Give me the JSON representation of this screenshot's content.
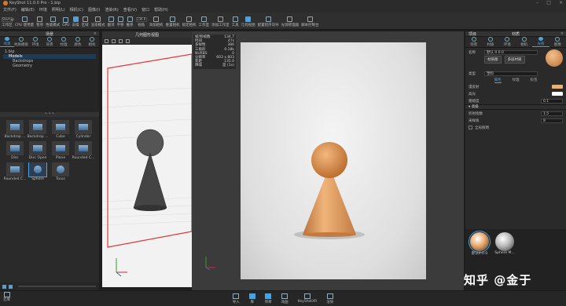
{
  "app": {
    "title": "KeyShot 11.0.0 Pro - 1.bip"
  },
  "menu": [
    "文件(F)",
    "编辑(E)",
    "环境",
    "照明(L)",
    "相机(C)",
    "图像(I)",
    "渲染(R)",
    "查看(V)",
    "窗口",
    "帮助(H)"
  ],
  "toolbar": {
    "workspace": "Startup",
    "cpu_usage": "CPU 使用量",
    "pause": "暂停",
    "perf_mode": "性能模式",
    "gpu": "GPU",
    "denoise": "去噪",
    "region": "区域",
    "render_mode": "渲染模式",
    "zoom": "136.0",
    "scene_tools": [
      "翻译",
      "平移",
      "推移"
    ],
    "perspective": "视角",
    "add_camera": "添加相机",
    "reset_camera": "重置相机",
    "lock_camera": "锁定相机",
    "tool": "工作室",
    "add_ws": "添加工作室",
    "model_tools": "工具",
    "geo_view": "几何视图",
    "config": "配置程序向导",
    "light_mgr": "光源管理器",
    "script": "脚本控制台"
  },
  "left": {
    "header": "场景",
    "tabs": [
      "场景",
      "材质模板",
      "环境",
      "背景",
      "纹理",
      "颜色",
      "相机"
    ],
    "active_tab": 0,
    "tree": [
      {
        "label": "1.bip",
        "indent": 0
      },
      {
        "label": "Models",
        "indent": 1,
        "sel": true
      },
      {
        "label": "Backdrops",
        "indent": 2
      },
      {
        "label": "Geometry",
        "indent": 2
      }
    ],
    "library": [
      "Backdrop ...",
      "Backdrop ...",
      "Cube",
      "Cylinder",
      "Disc",
      "Disc Open",
      "Plane",
      "Rounded C...",
      "Rounded C...",
      "Sphere",
      "Torus"
    ],
    "selected_index": 9
  },
  "geometry_view": {
    "title": "几何图形视图"
  },
  "stats": [
    [
      "帧/秒帧数",
      "134.7"
    ],
    [
      "时间",
      "47s"
    ],
    [
      "多样性",
      "386"
    ],
    [
      "三角形",
      "0.18k"
    ],
    [
      "NURBS",
      "0"
    ],
    [
      "分辨率",
      "603 x 803"
    ],
    [
      "焦距",
      "135.0"
    ],
    [
      "降噪",
      "是 (1x)"
    ]
  ],
  "right": {
    "header_left": "项目",
    "header_right": "材质",
    "tabs": [
      "场景",
      "材质",
      "环境",
      "相机",
      "光照",
      "图像"
    ],
    "active_tab": 4,
    "name_label": "名称",
    "name_value": "默认 0.0.0",
    "btn_graph": "材质图",
    "btn_multi": "多层材质",
    "type_label": "类型",
    "type_value": "塑料",
    "subtabs": [
      "属性",
      "纹理",
      "标签"
    ],
    "active_subtab": 0,
    "props": [
      {
        "label": "漫反射",
        "kind": "swatch",
        "color": "#e8b07a"
      },
      {
        "label": "高光",
        "kind": "swatch",
        "color": "#ffffff"
      },
      {
        "label": "粗糙度",
        "kind": "value",
        "value": "0.1"
      }
    ],
    "section": "高级",
    "adv": [
      {
        "label": "折射指数",
        "value": "1.5"
      },
      {
        "label": "采样值",
        "value": "8"
      }
    ],
    "checkbox": "全局照明",
    "materials": [
      "默认0.0.0",
      "Sphere M..."
    ],
    "mat_colors": [
      "#e8a66a",
      "#b8b8b8"
    ]
  },
  "bottom": [
    "导入",
    "库",
    "项目",
    "动画",
    "KeyShotXR",
    "渲染"
  ],
  "bottom_active": 1,
  "watermark": "知乎 @金于"
}
